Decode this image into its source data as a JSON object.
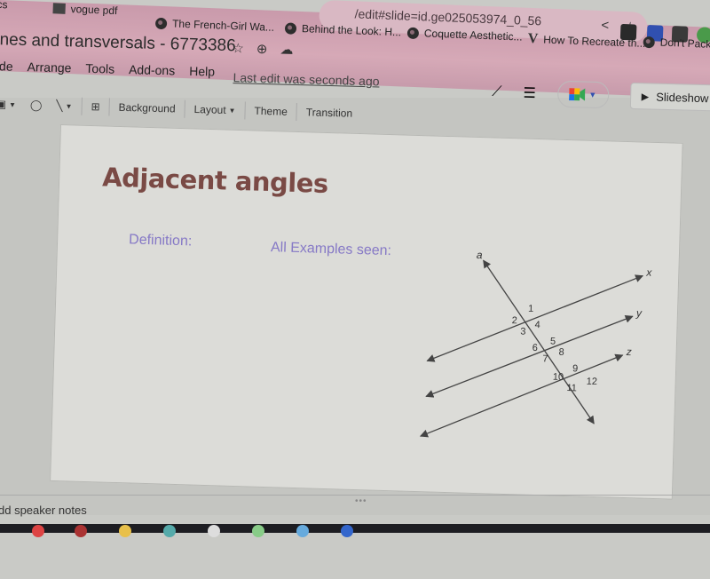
{
  "browser": {
    "url_fragment": "/edit#slide=id.ge025053974_0_56",
    "bookmarks": [
      {
        "label": "vogue pdf",
        "icon": "folder-icon"
      },
      {
        "label": "The French-Girl Wa...",
        "icon": "globe-icon"
      },
      {
        "label": "Behind the Look: H...",
        "icon": "globe-icon"
      },
      {
        "label": "Coquette Aesthetic...",
        "icon": "globe-icon"
      },
      {
        "label": "How To Recreate th...",
        "icon": "v-icon"
      },
      {
        "label": "Don't Pack fo",
        "icon": "globe-icon"
      }
    ],
    "bookmark_prefix_partial": "ocs",
    "colors": {
      "chrome": "#d6a9b7"
    }
  },
  "app": {
    "doc_title": "nes and transversals - 6773386",
    "menu": [
      "lide",
      "Arrange",
      "Tools",
      "Add-ons",
      "Help"
    ],
    "last_edit": "Last edit was seconds ago",
    "toolbar": {
      "background": "Background",
      "layout": "Layout",
      "theme": "Theme",
      "transition": "Transition"
    },
    "slideshow_label": "Slideshow",
    "speaker_notes_placeholder": "dd speaker notes"
  },
  "slide": {
    "title": "Adjacent angles",
    "definition_label": "Definition:",
    "examples_label": "All Examples seen:",
    "colors": {
      "title": "#7a4a45",
      "labels": "#8679c6"
    },
    "diagram": {
      "transversal_label": "a",
      "parallel_labels": [
        "x",
        "y",
        "z"
      ],
      "angle_numbers": [
        "1",
        "2",
        "3",
        "4",
        "5",
        "6",
        "7",
        "8",
        "9",
        "10",
        "11",
        "12"
      ]
    }
  }
}
